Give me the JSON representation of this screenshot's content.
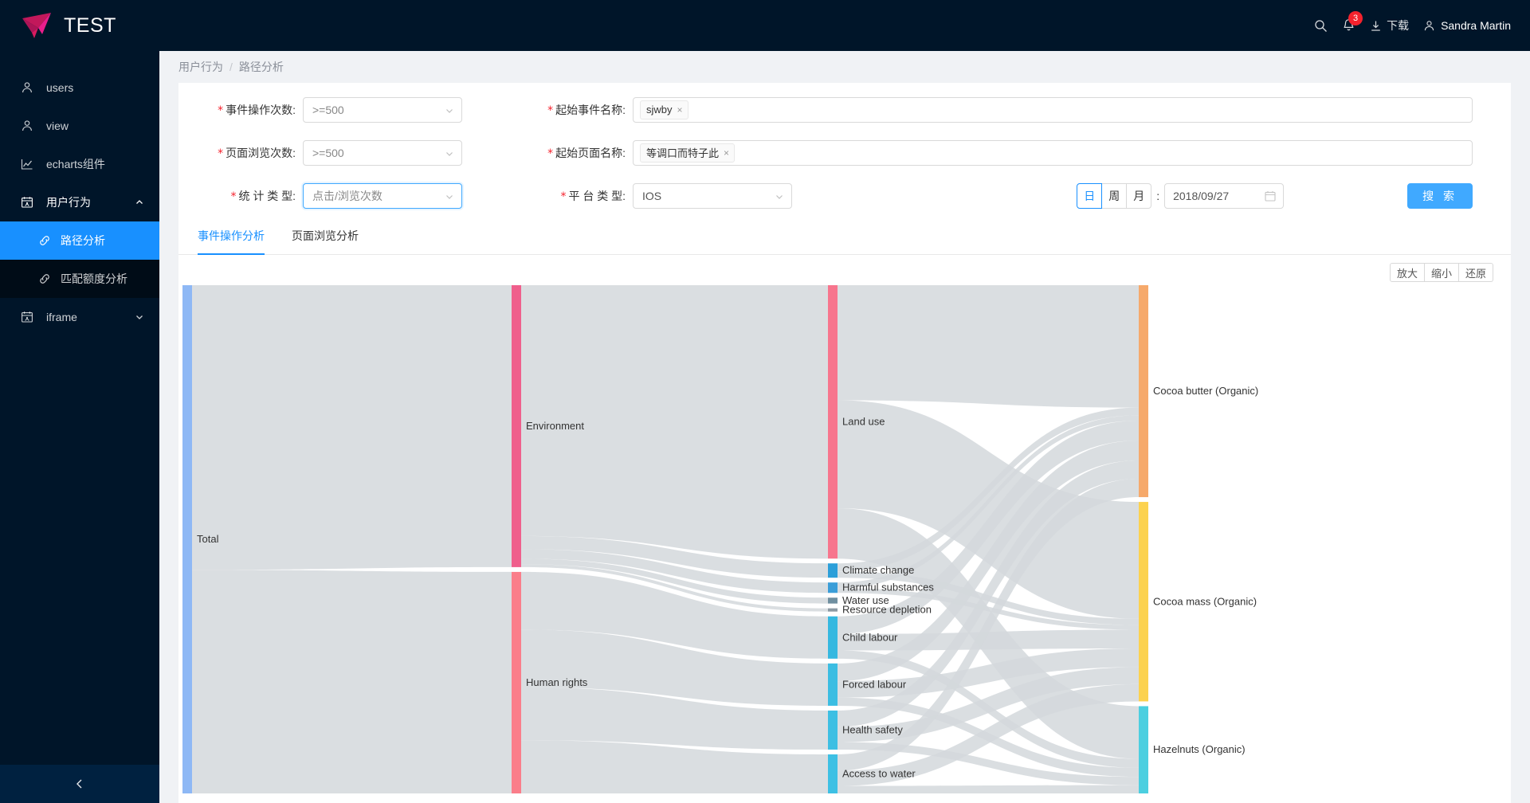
{
  "brand": {
    "title": "TEST",
    "logo_icon": "paper-plane-icon"
  },
  "topbar": {
    "search_icon": "search-icon",
    "bell_icon": "bell-icon",
    "notification_count": "3",
    "download_icon": "download-icon",
    "download_label": "下载",
    "user_icon": "user-icon",
    "user_name": "Sandra Martin"
  },
  "sidebar": {
    "items": [
      {
        "label": "users",
        "icon": "user-icon"
      },
      {
        "label": "view",
        "icon": "user-icon"
      },
      {
        "label": "echarts组件",
        "icon": "line-chart-icon"
      },
      {
        "label": "用户行为",
        "icon": "calendar-icon",
        "caret": "chevron-up-icon"
      },
      {
        "label": "iframe",
        "icon": "calendar-icon",
        "caret": "chevron-down-icon"
      }
    ],
    "submenu": [
      {
        "label": "路径分析",
        "icon": "link-icon",
        "active": true
      },
      {
        "label": "匹配额度分析",
        "icon": "link-icon",
        "active": false
      }
    ],
    "collapse_icon": "chevron-left-icon"
  },
  "breadcrumb": {
    "parent": "用户行为",
    "separator": "/",
    "current": "路径分析"
  },
  "form": {
    "event_count": {
      "label": "事件操作次数:",
      "value": ">=500",
      "required": true
    },
    "page_views": {
      "label": "页面浏览次数:",
      "value": ">=500",
      "required": true
    },
    "stat_type": {
      "label": "统 计 类 型:",
      "value": "点击/浏览次数",
      "required": true
    },
    "start_event": {
      "label": "起始事件名称:",
      "tag": "sjwby",
      "tag_close": "×",
      "required": true
    },
    "start_page": {
      "label": "起始页面名称:",
      "tag": "等调口而特子此",
      "tag_close": "×",
      "required": true
    },
    "platform": {
      "label": "平 台 类 型:",
      "value": "IOS",
      "required": true
    },
    "period": {
      "options": [
        "日",
        "周",
        "月"
      ],
      "selected": "日",
      "colon": ":"
    },
    "date": {
      "value": "2018/09/27",
      "icon": "calendar-icon"
    },
    "search_button": "搜 索"
  },
  "tabs": [
    {
      "label": "事件操作分析",
      "active": true
    },
    {
      "label": "页面浏览分析",
      "active": false
    }
  ],
  "chart_tools": [
    {
      "label": "放大"
    },
    {
      "label": "缩小"
    },
    {
      "label": "还原"
    }
  ],
  "chart_data": {
    "type": "sankey",
    "title": "",
    "node_colors": {
      "Total": "#8eb8f5",
      "Environment": "#ef5f8c",
      "Human rights": "#fa7e8a",
      "Land use": "#f7758d",
      "Climate change": "#2b9fd9",
      "Harmful substances": "#3b9ed8",
      "Water use": "#6f8fa0",
      "Resource depletion": "#8c9aa3",
      "Child labour": "#35b8e0",
      "Forced labour": "#3bbde2",
      "Health safety": "#3dbfe3",
      "Access to water": "#3dc0e4",
      "Cocoa butter (Organic)": "#f6a96b",
      "Cocoa mass (Organic)": "#fcd24f",
      "Hazelnuts (Organic)": "#4ccfe0"
    },
    "columns": [
      {
        "index": 0,
        "nodes": [
          "Total"
        ]
      },
      {
        "index": 1,
        "nodes": [
          "Environment",
          "Human rights"
        ]
      },
      {
        "index": 2,
        "nodes": [
          "Land use",
          "Climate change",
          "Harmful substances",
          "Water use",
          "Resource depletion",
          "Child labour",
          "Forced labour",
          "Health safety",
          "Access to water"
        ]
      },
      {
        "index": 3,
        "nodes": [
          "Cocoa butter (Organic)",
          "Cocoa mass (Organic)",
          "Hazelnuts (Organic)"
        ]
      }
    ],
    "nodes": [
      {
        "name": "Total",
        "column": 0,
        "value": 100
      },
      {
        "name": "Environment",
        "column": 1,
        "value": 56
      },
      {
        "name": "Human rights",
        "column": 1,
        "value": 44
      },
      {
        "name": "Land use",
        "column": 2,
        "value": 42
      },
      {
        "name": "Climate change",
        "column": 2,
        "value": 2.2
      },
      {
        "name": "Harmful substances",
        "column": 2,
        "value": 1.6
      },
      {
        "name": "Water use",
        "column": 2,
        "value": 0.9
      },
      {
        "name": "Resource depletion",
        "column": 2,
        "value": 0.5
      },
      {
        "name": "Child labour",
        "column": 2,
        "value": 6.5
      },
      {
        "name": "Forced labour",
        "column": 2,
        "value": 6.5
      },
      {
        "name": "Health safety",
        "column": 2,
        "value": 6.0
      },
      {
        "name": "Access to water",
        "column": 2,
        "value": 6.0
      },
      {
        "name": "Cocoa butter (Organic)",
        "column": 3,
        "value": 34
      },
      {
        "name": "Cocoa mass (Organic)",
        "column": 3,
        "value": 32
      },
      {
        "name": "Hazelnuts (Organic)",
        "column": 3,
        "value": 14
      }
    ],
    "links": [
      {
        "source": "Total",
        "target": "Environment",
        "value": 56
      },
      {
        "source": "Total",
        "target": "Human rights",
        "value": 44
      },
      {
        "source": "Environment",
        "target": "Land use",
        "value": 42
      },
      {
        "source": "Environment",
        "target": "Climate change",
        "value": 2.2
      },
      {
        "source": "Environment",
        "target": "Harmful substances",
        "value": 1.6
      },
      {
        "source": "Environment",
        "target": "Water use",
        "value": 0.9
      },
      {
        "source": "Environment",
        "target": "Resource depletion",
        "value": 0.5
      },
      {
        "source": "Human rights",
        "target": "Child labour",
        "value": 6.5
      },
      {
        "source": "Human rights",
        "target": "Forced labour",
        "value": 6.5
      },
      {
        "source": "Human rights",
        "target": "Health safety",
        "value": 6.0
      },
      {
        "source": "Human rights",
        "target": "Access to water",
        "value": 6.0
      },
      {
        "source": "Land use",
        "target": "Cocoa butter (Organic)",
        "value": 16
      },
      {
        "source": "Land use",
        "target": "Cocoa mass (Organic)",
        "value": 15
      },
      {
        "source": "Land use",
        "target": "Hazelnuts (Organic)",
        "value": 7
      },
      {
        "source": "Climate change",
        "target": "Cocoa butter (Organic)",
        "value": 1.0
      },
      {
        "source": "Climate change",
        "target": "Cocoa mass (Organic)",
        "value": 0.8
      },
      {
        "source": "Harmful substances",
        "target": "Cocoa butter (Organic)",
        "value": 0.7
      },
      {
        "source": "Harmful substances",
        "target": "Cocoa mass (Organic)",
        "value": 0.6
      },
      {
        "source": "Child labour",
        "target": "Cocoa butter (Organic)",
        "value": 2.6
      },
      {
        "source": "Child labour",
        "target": "Cocoa mass (Organic)",
        "value": 2.4
      },
      {
        "source": "Child labour",
        "target": "Hazelnuts (Organic)",
        "value": 1.2
      },
      {
        "source": "Forced labour",
        "target": "Cocoa butter (Organic)",
        "value": 2.6
      },
      {
        "source": "Forced labour",
        "target": "Cocoa mass (Organic)",
        "value": 2.4
      },
      {
        "source": "Forced labour",
        "target": "Hazelnuts (Organic)",
        "value": 1.2
      },
      {
        "source": "Health safety",
        "target": "Cocoa butter (Organic)",
        "value": 2.4
      },
      {
        "source": "Health safety",
        "target": "Cocoa mass (Organic)",
        "value": 2.2
      },
      {
        "source": "Health safety",
        "target": "Hazelnuts (Organic)",
        "value": 1.1
      },
      {
        "source": "Access to water",
        "target": "Cocoa butter (Organic)",
        "value": 2.4
      },
      {
        "source": "Access to water",
        "target": "Cocoa mass (Organic)",
        "value": 2.2
      },
      {
        "source": "Access to water",
        "target": "Hazelnuts (Organic)",
        "value": 1.1
      }
    ],
    "link_color": "#d4d8dc"
  }
}
